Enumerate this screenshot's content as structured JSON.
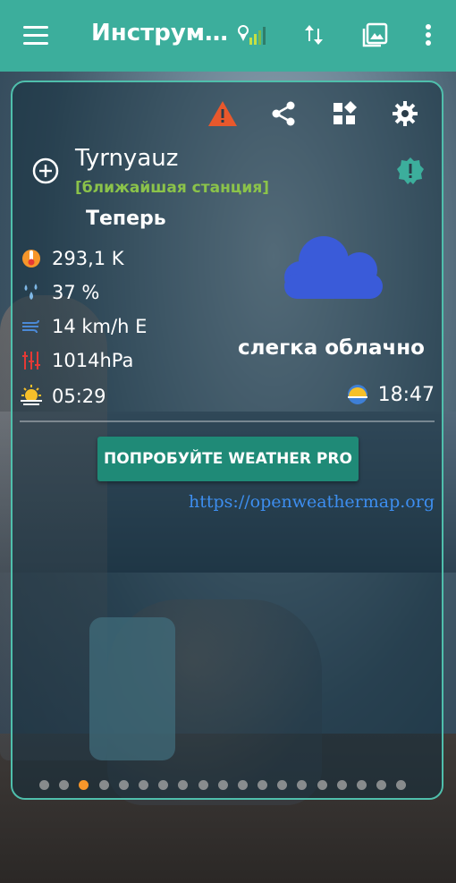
{
  "appbar": {
    "title": "Инструм…",
    "colors": {
      "background": "#3cae9c"
    },
    "icons": [
      "menu-icon",
      "signal-location-icon",
      "swap-vertical-icon",
      "gallery-icon",
      "more-vert-icon"
    ]
  },
  "card": {
    "icons": [
      "warning-icon",
      "share-icon",
      "widgets-icon",
      "settings-icon",
      "add-location-icon",
      "verified-badge-icon"
    ],
    "city": "Tyrnyauz",
    "station": "[ближайшая станция]",
    "now_label": "Теперь",
    "temperature": "293,1 K",
    "humidity": "37 %",
    "wind": "14 km/h E",
    "pressure": "1014hPa",
    "sunrise": "05:29",
    "sunset": "18:47",
    "condition": "слегка облачно",
    "pro_button": "ПОПРОБУЙТЕ WEATHER PRO",
    "link": "https://openweathermap.org"
  },
  "pager": {
    "count": 19,
    "active_index": 2
  },
  "colors": {
    "accent": "#3cae9c",
    "warning": "#e8582c",
    "station_text": "#8bc34a",
    "cloud": "#3a5bd9",
    "button": "#1f8a77",
    "link": "#3d8eef",
    "active_dot": "#f6962a"
  }
}
